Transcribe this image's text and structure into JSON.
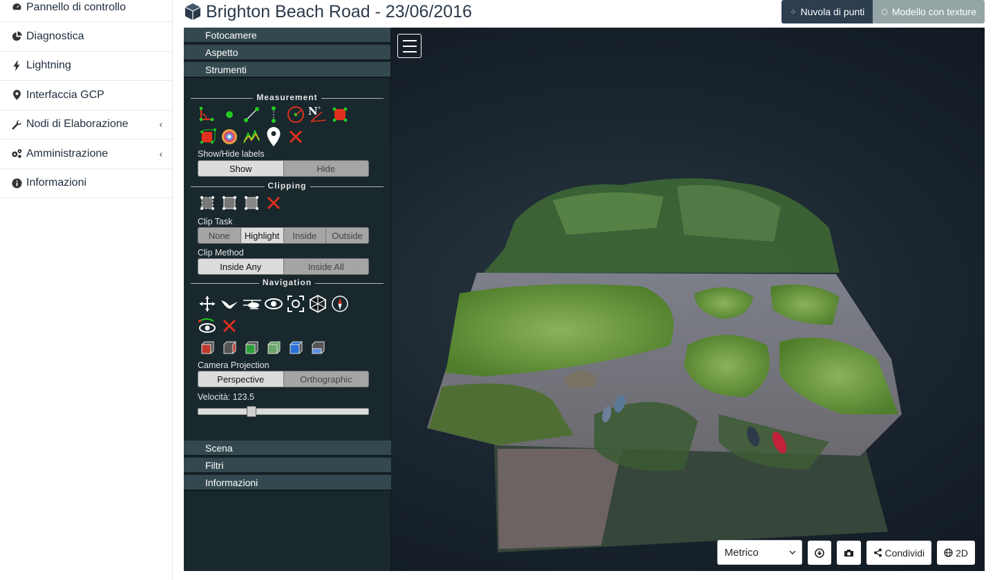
{
  "nav": {
    "items": [
      {
        "label": "Pannello di controllo",
        "icon": "dashboard-icon",
        "chevron": false
      },
      {
        "label": "Diagnostica",
        "icon": "chart-pie-icon",
        "chevron": false
      },
      {
        "label": "Lightning",
        "icon": "bolt-icon",
        "chevron": false
      },
      {
        "label": "Interfaccia GCP",
        "icon": "map-marker-icon",
        "chevron": false
      },
      {
        "label": "Nodi di Elaborazione",
        "icon": "wrench-icon",
        "chevron": true
      },
      {
        "label": "Amministrazione",
        "icon": "cogs-icon",
        "chevron": true
      },
      {
        "label": "Informazioni",
        "icon": "info-circle-icon",
        "chevron": false
      }
    ],
    "chevron_glyph": "‹"
  },
  "header": {
    "title": "Brighton Beach Road - 23/06/2016",
    "title_icon": "cube-icon",
    "point_cloud_label": "Nuvola di punti",
    "textured_model_label": "Modello con texture"
  },
  "sidebar": {
    "top_sections": [
      "Fotocamere",
      "Aspetto",
      "Strumenti"
    ],
    "bottom_sections": [
      "Scena",
      "Filtri",
      "Informazioni"
    ],
    "measurement": {
      "title": "Measurement",
      "show_hide_label": "Show/Hide labels",
      "show": "Show",
      "hide": "Hide"
    },
    "clipping": {
      "title": "Clipping",
      "clip_task_label": "Clip Task",
      "clip_task_options": [
        "None",
        "Highlight",
        "Inside",
        "Outside"
      ],
      "clip_task_selected": "Highlight",
      "clip_method_label": "Clip Method",
      "clip_method_options": [
        "Inside Any",
        "Inside All"
      ],
      "clip_method_selected": "Inside Any"
    },
    "navigation": {
      "title": "Navigation",
      "camera_projection_label": "Camera Projection",
      "perspective": "Perspective",
      "orthographic": "Orthographic",
      "speed_label": "Velocità: 123.5",
      "speed_fraction": 0.3
    }
  },
  "controls": {
    "units_selected": "Metrico",
    "share_label": "Condividi",
    "view2d_label": "2D"
  },
  "colors": {
    "nav_dark": "#2c3e50",
    "accent_gray": "#95a5a6",
    "sidebar_bg": "#19282c",
    "section_header": "#34494f",
    "tool_red": "#e0301e",
    "tool_green": "#22cc22"
  }
}
